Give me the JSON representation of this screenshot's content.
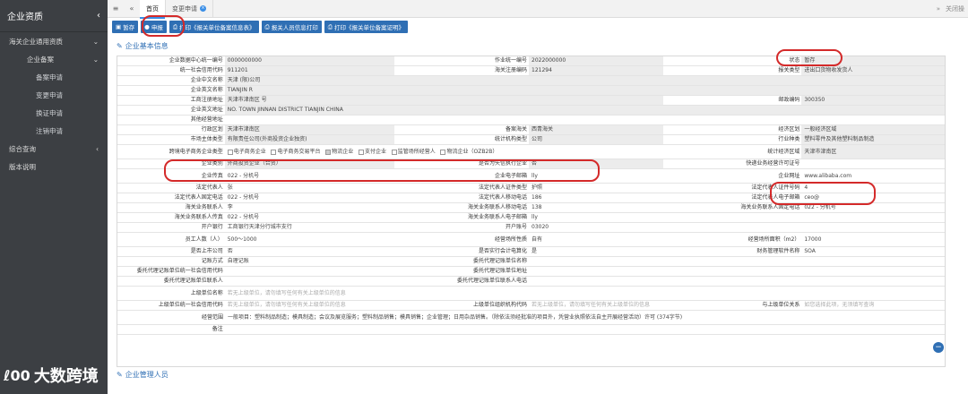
{
  "sidebar": {
    "title": "企业资质",
    "items": [
      {
        "label": "海关企业通用资质",
        "level": 1
      },
      {
        "label": "企业备案",
        "level": 2
      },
      {
        "label": "备案申请",
        "level": 3
      },
      {
        "label": "变更申请",
        "level": 3
      },
      {
        "label": "换证申请",
        "level": 3
      },
      {
        "label": "注销申请",
        "level": 3
      },
      {
        "label": "综合查询",
        "level": 1
      },
      {
        "label": "版本说明",
        "level": 0
      }
    ]
  },
  "topbar": {
    "tabs": [
      {
        "label": "首页"
      },
      {
        "label": "变更申请"
      }
    ],
    "right_label": "关闭操"
  },
  "toolbar": {
    "buttons": [
      {
        "label": "暂存"
      },
      {
        "label": "申报"
      },
      {
        "label": "打印《报关单位备案信息表》"
      },
      {
        "label": "报关人员信息打印"
      },
      {
        "label": "打印《报关单位备案证明》"
      }
    ]
  },
  "sections": {
    "basic": "企业基本信息",
    "mgmt": "企业管理人员"
  },
  "form": {
    "r1": {
      "l1": "企业数据中心统一编号",
      "v1": "0000000000",
      "l2": "作业统一编号",
      "v2": "2022000000",
      "l3": "状态",
      "v3": "暂存"
    },
    "r2": {
      "l1": "统一社会信用代码",
      "v1": "911201",
      "l2": "海关注册编码",
      "v2": "121294",
      "l3": "报关类型",
      "v3": "进出口货物收发货人"
    },
    "r3": {
      "l1": "企业中文名称",
      "v1": "天津                  (限)公司"
    },
    "r4": {
      "l1": "企业英文名称",
      "v1": "TIANJIN                                  R"
    },
    "r5": {
      "l1": "工商注册地址",
      "v1": "天津市津南区                                 号",
      "l3": "邮政编码",
      "v3": "300350"
    },
    "r6": {
      "l1": "企业英文地址",
      "v1": "NO.                                          TOWN JINNAN DISTRICT TIANJIN CHINA"
    },
    "r7": {
      "l1": "其他经营地址",
      "v1": ""
    },
    "r8": {
      "l1": "行政区划",
      "v1": "天津市津南区",
      "l2": "备案海关",
      "v2": "西青海关",
      "l3": "经济区划",
      "v3": "一般经济区域"
    },
    "r9": {
      "l1": "市场主体类型",
      "v1": "有限责任公司(外商投资企业独资)",
      "l2": "统计机构类型",
      "v2": "公司",
      "l3": "行业种类",
      "v3": "塑料零件及其他塑料制品制造"
    },
    "r10": {
      "l1": "跨境电子商务企业类型",
      "opts": [
        "电子商务企业",
        "电子商务交易平台",
        "物流企业",
        "支付企业",
        "监管场所经营人",
        "物流企业（OZB2B）"
      ],
      "l3": "统计经济区域",
      "v3": "天津市津南区"
    },
    "r11": {
      "l1": "企业类别",
      "v1": "外商投资企业（合资）",
      "l2": "是否为失信执行企业",
      "v2": "否",
      "l3": "快递业务经营许可证号",
      "v3": ""
    },
    "r12": {
      "l1": "企业传真",
      "v1": "022        -                         分机号",
      "l2": "企业电子邮箱",
      "v2": "lly",
      "l3": "企业网址",
      "v3": "www.alibaba.com"
    },
    "r13": {
      "l1": "法定代表人",
      "v1": "张",
      "l2": "法定代表人证件类型",
      "v2": "护照",
      "l3": "法定代表人证件号码",
      "v3": "4"
    },
    "r14": {
      "l1": "法定代表人固定电话",
      "v1": "022        -                         分机号",
      "l2": "法定代表人移动电话",
      "v2": "186",
      "l3": "法定代表人电子邮箱",
      "v3": "ceo@"
    },
    "r15": {
      "l1": "海关业务联系人",
      "v1": "李",
      "l2": "海关业务联系人移动电话",
      "v2": "138",
      "l3": "海关业务联系人固定电话",
      "v3": "022        -                     分机号"
    },
    "r16": {
      "l1": "海关业务联系人传真",
      "v1": "022        -                         分机号",
      "l2": "海关业务联系人电子邮箱",
      "v2": "lly"
    },
    "r17": {
      "l1": "开户银行",
      "v1": "工商银行天津分行城市支行",
      "l2": "开户账号",
      "v2": "03020"
    },
    "r18": {
      "l1": "员工人数（人）",
      "v1": "500～1000",
      "l2": "经营场所性质",
      "v2": "自有",
      "l3": "经营场所面积（m2）",
      "v3": "17000"
    },
    "r19": {
      "l1": "是否上市公司",
      "v1": "否",
      "l2": "是否实行会计电算化",
      "v2": "是",
      "l3": "财务管理软件名称",
      "v3": "SOA"
    },
    "r20": {
      "l1": "记账方式",
      "v1": "自理记账",
      "l2": "委托代理记账单位名称",
      "v2": ""
    },
    "r21": {
      "l1": "委托代理记账单位统一社会信用代码",
      "v1": "",
      "l2": "委托代理记账单位地址",
      "v2": ""
    },
    "r22": {
      "l1": "委托代理记账单位联系人",
      "v1": "",
      "l2": "委托代理记账单位联系人电话",
      "v2": ""
    },
    "r23": {
      "l1": "上级单位名称",
      "v1": "若无上级单位，请勿填写任何有关上级单位的信息"
    },
    "r24": {
      "l1": "上级单位统一社会信用代码",
      "v1": "若无上级单位，请勿填写任何有关上级单位的信息",
      "l2": "上级单位组织机构代码",
      "v2": "若无上级单位，请勿填写任何有关上级单位的信息",
      "l3": "与上级单位关系",
      "v3": "如您选择此项，无须填写查询"
    },
    "r25": {
      "l1": "经营范围",
      "v1": "一般项目：塑料制品制造；模具制造；会议及展览服务；塑料制品销售；模具销售；企业管理；日用杂品销售。（除依法须经批准的项目外，凭营业执照依法自主开展经营活动）许可    (374字节)"
    },
    "r26": {
      "l1": "备注",
      "v1": ""
    }
  },
  "watermark": {
    "logo": "ℓ00",
    "text": "大数跨境"
  }
}
